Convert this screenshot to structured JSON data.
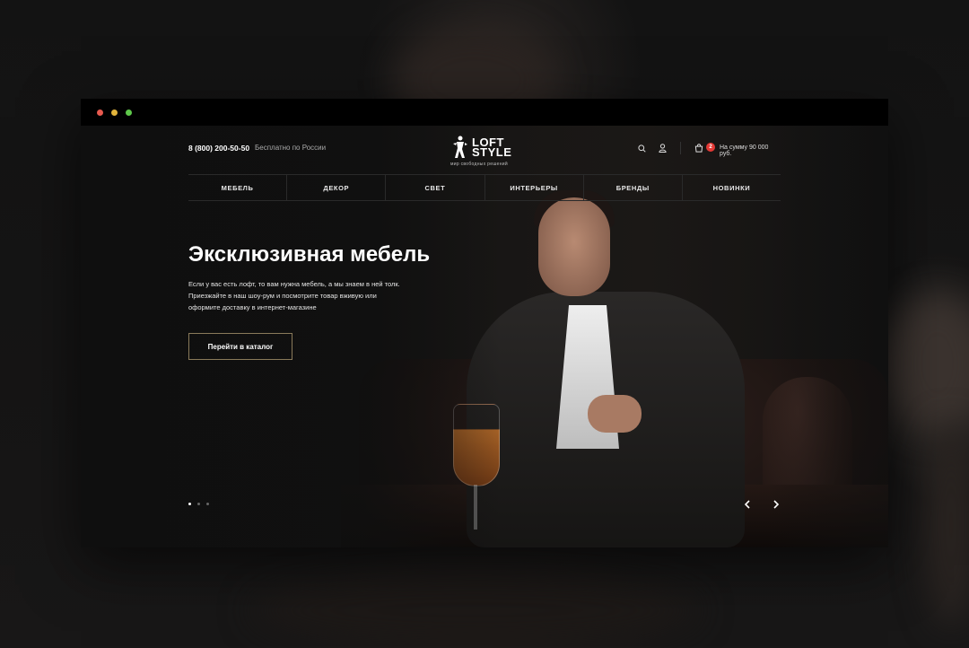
{
  "window": {
    "controls": [
      "close",
      "minimize",
      "maximize"
    ]
  },
  "header": {
    "phone": "8 (800) 200-50-50",
    "phone_note": "Бесплатно по России",
    "logo": {
      "line1": "LOFT",
      "line2": "STYLE",
      "tagline": "мир свободных решений"
    },
    "icons": {
      "search": "search-icon",
      "user": "user-icon",
      "cart": "cart-icon"
    },
    "cart_count": "2",
    "cart_sum": "На сумму 90 000 руб."
  },
  "nav": {
    "items": [
      {
        "label": "МЕБЕЛЬ"
      },
      {
        "label": "ДЕКОР"
      },
      {
        "label": "СВЕТ"
      },
      {
        "label": "ИНТЕРЬЕРЫ"
      },
      {
        "label": "БРЕНДЫ"
      },
      {
        "label": "НОВИНКИ"
      }
    ]
  },
  "hero": {
    "title": "Эксклюзивная мебель",
    "description": "Если у вас есть лофт, то вам нужна мебель, а мы знаем в ней толк. Приезжайте в наш шоу-рум и посмотрите товар вживую или оформите доставку в интернет-магазине",
    "cta_label": "Перейти в каталог",
    "slides_total": 3,
    "active_slide": 1
  },
  "colors": {
    "accent_border": "#8a7a5a",
    "badge": "#e53935",
    "background": "#0f0f0f"
  }
}
